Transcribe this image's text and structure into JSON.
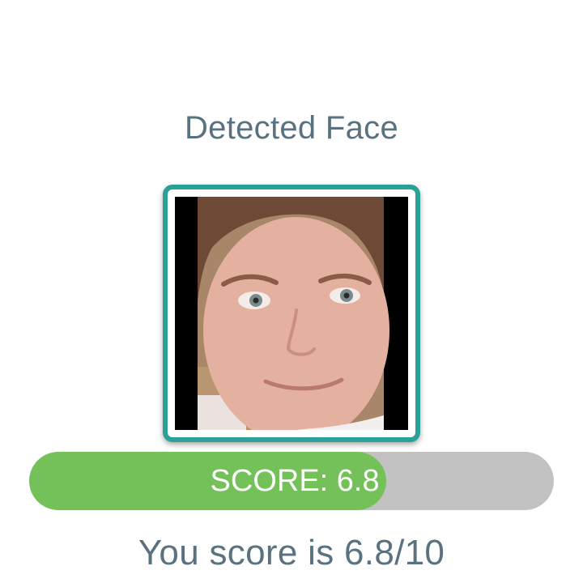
{
  "header": {
    "title": "Detected Face"
  },
  "face": {
    "icon": "detected-face-photo",
    "frame_color": "#2aa198"
  },
  "score_bar": {
    "label": "SCORE: 6.8",
    "fill_fraction": 0.68,
    "fill_color": "#74c15a",
    "track_color": "#c2c2c2"
  },
  "result": {
    "text": "You score is 6.8/10"
  }
}
